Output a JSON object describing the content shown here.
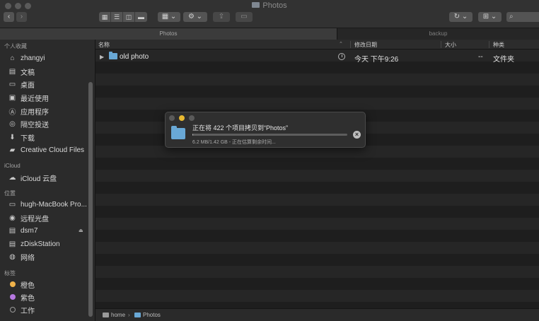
{
  "window": {
    "title": "Photos",
    "nav": {
      "back": "‹",
      "forward": "›"
    },
    "view_modes": [
      "icons",
      "list",
      "columns",
      "gallery"
    ],
    "active_view": "list"
  },
  "tabs": [
    {
      "label": "Photos",
      "active": true
    },
    {
      "label": "backup",
      "active": false
    }
  ],
  "sidebar": {
    "sections": [
      {
        "heading": "个人收藏",
        "items": [
          {
            "label": "zhangyi",
            "icon": "home-icon"
          },
          {
            "label": "文稿",
            "icon": "documents-icon"
          },
          {
            "label": "桌面",
            "icon": "desktop-icon"
          },
          {
            "label": "最近使用",
            "icon": "recents-icon"
          },
          {
            "label": "应用程序",
            "icon": "applications-icon"
          },
          {
            "label": "隔空投送",
            "icon": "airdrop-icon"
          },
          {
            "label": "下载",
            "icon": "downloads-icon"
          },
          {
            "label": "Creative Cloud Files",
            "icon": "folder-icon"
          }
        ]
      },
      {
        "heading": "iCloud",
        "items": [
          {
            "label": "iCloud 云盘",
            "icon": "cloud-icon"
          }
        ]
      },
      {
        "heading": "位置",
        "items": [
          {
            "label": "hugh-MacBook Pro...",
            "icon": "laptop-icon"
          },
          {
            "label": "远程光盘",
            "icon": "disc-icon"
          },
          {
            "label": "dsm7",
            "icon": "server-icon",
            "eject": "⏏"
          },
          {
            "label": "zDiskStation",
            "icon": "server-icon"
          },
          {
            "label": "网络",
            "icon": "network-icon"
          }
        ]
      },
      {
        "heading": "标签",
        "items": [
          {
            "label": "橙色",
            "icon": "tag-dot-icon",
            "color": "#f0b24a"
          },
          {
            "label": "紫色",
            "icon": "tag-dot-icon",
            "color": "#b678e0"
          },
          {
            "label": "工作",
            "icon": "tag-dot-icon",
            "color": "#2b2b2b"
          }
        ]
      }
    ]
  },
  "columns": {
    "name": "名称",
    "modified": "修改日期",
    "size": "大小",
    "kind": "种类"
  },
  "files": [
    {
      "name": "old photo",
      "modified": "今天 下午9:26",
      "size": "--",
      "kind": "文件夹"
    }
  ],
  "path_bar": [
    "home",
    "Photos"
  ],
  "copy_dialog": {
    "title": "正在将 422 个项目拷贝到“Photos”",
    "status": "6.2 MB/1.42 GB - 正在估算剩余时间...",
    "progress": 0.004
  },
  "colors": {
    "accent_folder": "#69a8d6",
    "tag_orange": "#f0b24a",
    "tag_purple": "#b678e0",
    "dialog_yellow": "#e8b931"
  }
}
